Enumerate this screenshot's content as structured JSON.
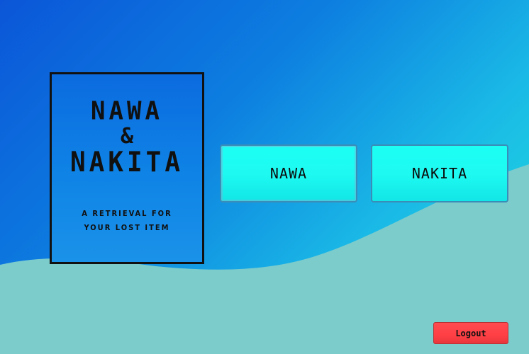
{
  "poster": {
    "title_line1": "NAWA",
    "title_amp": "&",
    "title_line2": "NAKITA",
    "subtitle": "A RETRIEVAL FOR YOUR LOST ITEM"
  },
  "buttons": {
    "nawa_label": "NAWA",
    "nakita_label": "NAKITA",
    "logout_label": "Logout"
  },
  "colors": {
    "background_gradient_start": "#0b56d8",
    "background_gradient_end": "#22e3dc",
    "wave_fill": "#7ccccc",
    "choice_button_fill": "#1cfff5",
    "logout_button_fill": "#ff4b50",
    "poster_border": "#111111"
  }
}
